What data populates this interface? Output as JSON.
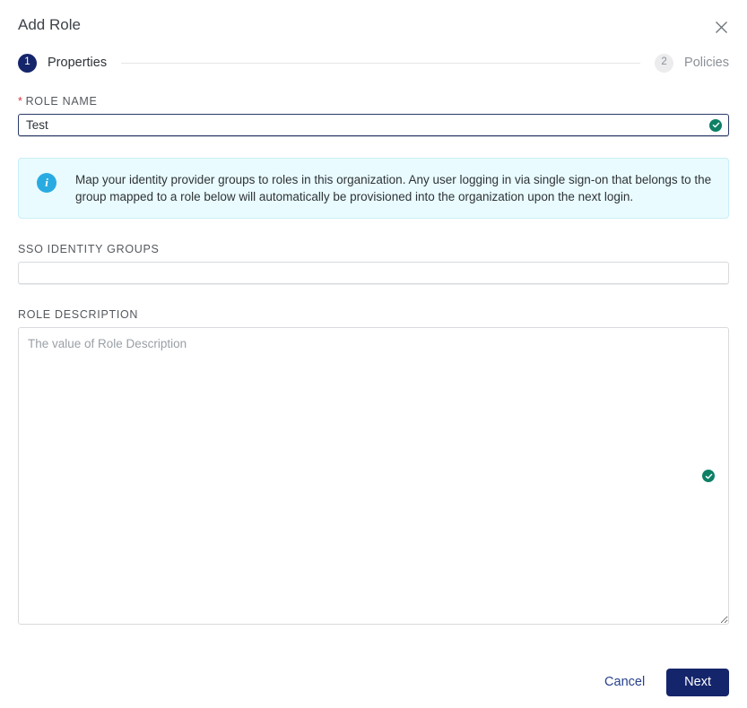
{
  "dialog": {
    "title": "Add Role",
    "close_icon": "close-icon"
  },
  "stepper": {
    "steps": [
      {
        "number": "1",
        "label": "Properties",
        "state": "active"
      },
      {
        "number": "2",
        "label": "Policies",
        "state": "inactive"
      }
    ]
  },
  "form": {
    "role_name": {
      "label": "ROLE NAME",
      "required_marker": "*",
      "value": "Test",
      "placeholder": "",
      "valid_icon": "check-circle-icon"
    },
    "sso_identity_groups": {
      "label": "SSO IDENTITY GROUPS",
      "value": "",
      "placeholder": ""
    },
    "role_description": {
      "label": "ROLE DESCRIPTION",
      "value": "",
      "placeholder": "The value of Role Description",
      "valid_icon": "check-circle-icon"
    }
  },
  "banner": {
    "icon": "info-circle-icon",
    "text": "Map your identity provider groups to roles in this organization. Any user logging in via single sign-on that belongs to the group mapped to a role below will automatically be provisioned into the organization upon the next login."
  },
  "footer": {
    "cancel_label": "Cancel",
    "next_label": "Next"
  },
  "colors": {
    "primary_navy": "#15256b",
    "link_navy": "#27408b",
    "info_blue": "#29abe2",
    "banner_bg": "#e9fbfe",
    "success_green": "#0d8066",
    "required_red": "#d7373f"
  }
}
